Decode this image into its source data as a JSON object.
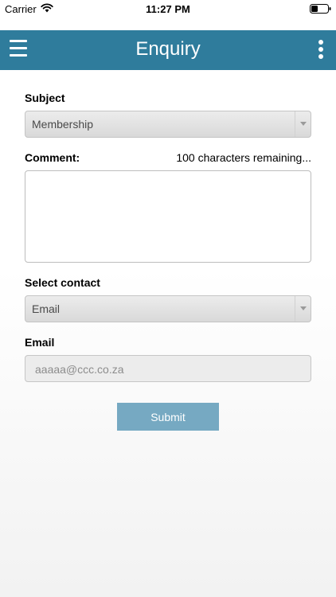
{
  "status_bar": {
    "carrier": "Carrier",
    "time": "11:27 PM",
    "icons": [
      "wifi-icon",
      "battery-icon"
    ]
  },
  "app_bar": {
    "title": "Enquiry",
    "icons": [
      "menu-icon",
      "more-vertical-icon"
    ],
    "color": "#2f7c9c"
  },
  "form": {
    "subject_label": "Subject",
    "subject_value": "Membership",
    "comment_label": "Comment:",
    "comment_counter": "100 characters remaining...",
    "comment_value": "",
    "contact_label": "Select contact",
    "contact_value": "Email",
    "email_label": "Email",
    "email_value": "aaaaa@ccc.co.za",
    "submit_label": "Submit",
    "submit_color": "#76a9c2"
  }
}
